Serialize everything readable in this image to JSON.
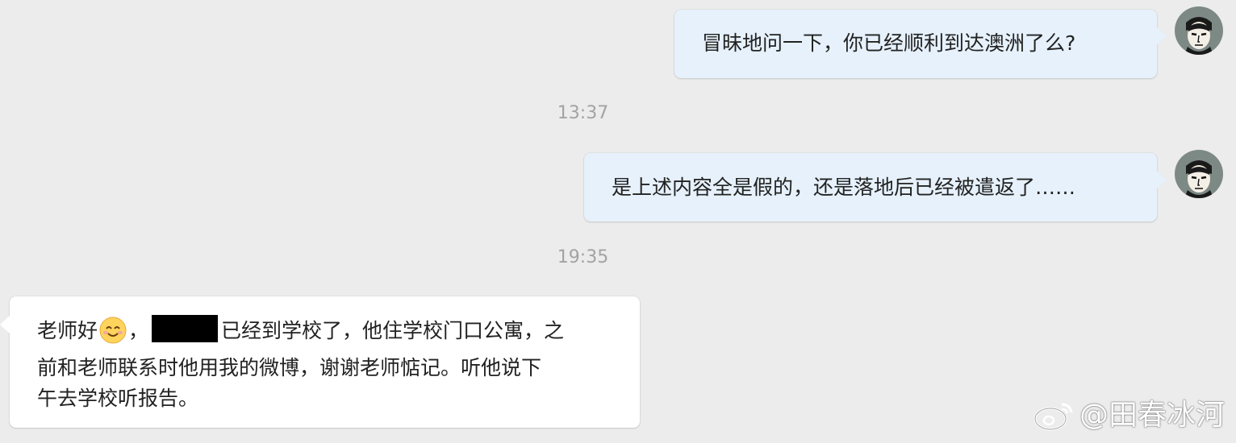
{
  "messages": [
    {
      "direction": "outgoing",
      "text": "冒昧地问一下，你已经顺利到达澳洲了么?"
    },
    {
      "direction": "outgoing",
      "text": "是上述内容全是假的，还是落地后已经被遣返了……"
    },
    {
      "direction": "incoming",
      "line1_prefix": "老师好",
      "line1_sep": "，",
      "line1_suffix": "已经到学校了，他住学校门口公寓，之",
      "line2": "前和老师联系时他用我的微博，谢谢老师惦记。听他说下",
      "line3": "午去学校听报告。"
    }
  ],
  "timestamps": [
    "13:37",
    "19:35"
  ],
  "watermark": "@田春冰河",
  "icons": {
    "avatar": "avatar-icon",
    "emoji": "smile-emoji-icon",
    "weibo": "weibo-logo-icon"
  },
  "colors": {
    "background": "#ececec",
    "outgoing_bubble": "#e6f1fb",
    "incoming_bubble": "#ffffff",
    "timestamp": "#a3a3a3"
  }
}
